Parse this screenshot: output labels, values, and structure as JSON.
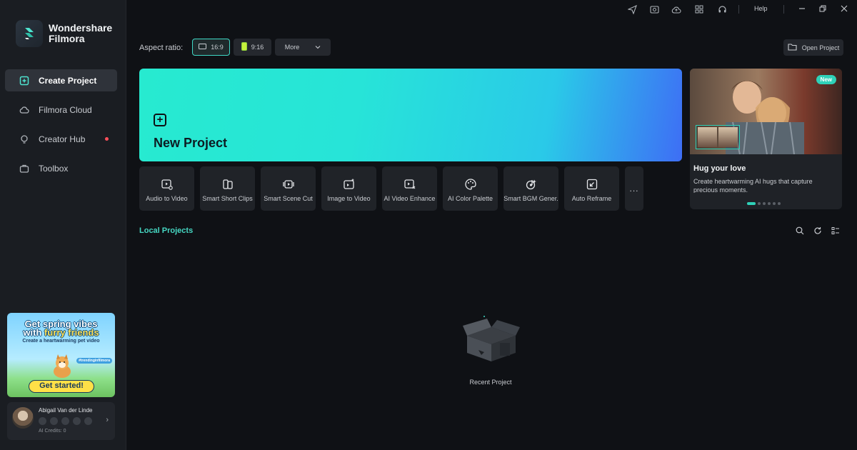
{
  "brand": {
    "line1": "Wondershare",
    "line2": "Filmora"
  },
  "nav": [
    {
      "label": "Create Project",
      "icon": "plus-square-icon",
      "active": true
    },
    {
      "label": "Filmora Cloud",
      "icon": "cloud-icon"
    },
    {
      "label": "Creator Hub",
      "icon": "bulb-icon",
      "dot": true
    },
    {
      "label": "Toolbox",
      "icon": "toolbox-icon"
    }
  ],
  "promo": {
    "line1": "Get spring vibes",
    "line2a": "with ",
    "line2b": "furry friends",
    "subtitle": "Create a heartwarming pet video",
    "tag": "#trendinginfilmora",
    "cta": "Get started!"
  },
  "user": {
    "name": "Abigail Van der Linde",
    "credits": "AI Credits: 0"
  },
  "topbar": {
    "help": "Help"
  },
  "aspect": {
    "label": "Aspect ratio:",
    "options": [
      {
        "label": "16:9",
        "active": true
      },
      {
        "label": "9:16"
      }
    ],
    "more": "More"
  },
  "open_project": "Open Project",
  "new_project": "New Project",
  "tools": [
    {
      "label": "Audio to Video",
      "icon": "audio-to-video-icon"
    },
    {
      "label": "Smart Short Clips",
      "icon": "smart-short-clips-icon"
    },
    {
      "label": "Smart Scene Cut",
      "icon": "smart-scene-cut-icon"
    },
    {
      "label": "Image to Video",
      "icon": "image-to-video-icon"
    },
    {
      "label": "AI Video Enhance",
      "icon": "ai-video-enhance-icon"
    },
    {
      "label": "AI Color Palette",
      "icon": "ai-color-palette-icon"
    },
    {
      "label": "Smart BGM Gener.",
      "icon": "smart-bgm-icon"
    },
    {
      "label": "Auto Reframe",
      "icon": "auto-reframe-icon"
    }
  ],
  "tools_more": "...",
  "feature_card": {
    "badge": "New",
    "title": "Hug your love",
    "description": "Create heartwarming AI hugs that capture precious moments.",
    "slides": 6,
    "active_slide": 1
  },
  "local_projects": {
    "title": "Local Projects",
    "empty_label": "Recent Project"
  },
  "colors": {
    "accent": "#2fd1b8",
    "background": "#0f1115",
    "sidebar": "#1a1d22"
  }
}
